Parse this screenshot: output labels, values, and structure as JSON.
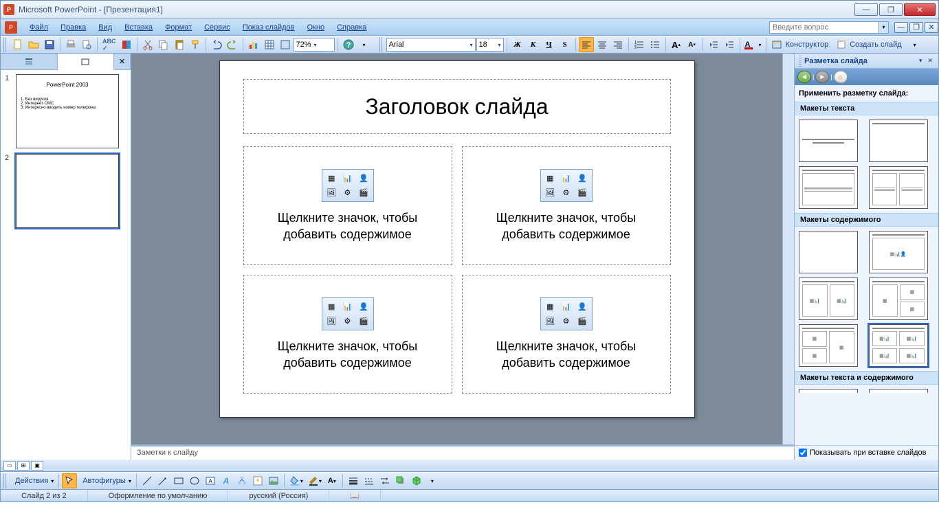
{
  "window": {
    "title": "Microsoft PowerPoint - [Презентация1]"
  },
  "menu": {
    "file": "Файл",
    "edit": "Правка",
    "view": "Вид",
    "insert": "Вставка",
    "format": "Формат",
    "tools": "Сервис",
    "slideshow": "Показ слайдов",
    "window": "Окно",
    "help": "Справка",
    "searchPlaceholder": "Введите вопрос"
  },
  "toolbar1": {
    "zoom": "72%"
  },
  "toolbar2": {
    "font": "Arial",
    "size": "18",
    "designer": "Конструктор",
    "newslide": "Создать слайд"
  },
  "thumbs": {
    "slide1": {
      "num": "1",
      "title": "PowerPoint 2003",
      "b1": "1. Без вирусов",
      "b2": "2. Интернет CMC",
      "b3": "3. Интересно вводить номер телефона"
    },
    "slide2": {
      "num": "2"
    }
  },
  "slide": {
    "titlePlaceholder": "Заголовок слайда",
    "contentPlaceholder": "Щелкните значок, чтобы добавить содержимое"
  },
  "notes": {
    "placeholder": "Заметки к слайду"
  },
  "taskpane": {
    "title": "Разметка слайда",
    "apply": "Применить разметку слайда:",
    "sec1": "Макеты текста",
    "sec2": "Макеты содержимого",
    "sec3": "Макеты текста и содержимого",
    "showOnInsert": "Показывать при вставке слайдов"
  },
  "drawbar": {
    "actions": "Действия",
    "autoshapes": "Автофигуры"
  },
  "status": {
    "slide": "Слайд 2 из 2",
    "design": "Оформление по умолчанию",
    "lang": "русский (Россия)"
  }
}
